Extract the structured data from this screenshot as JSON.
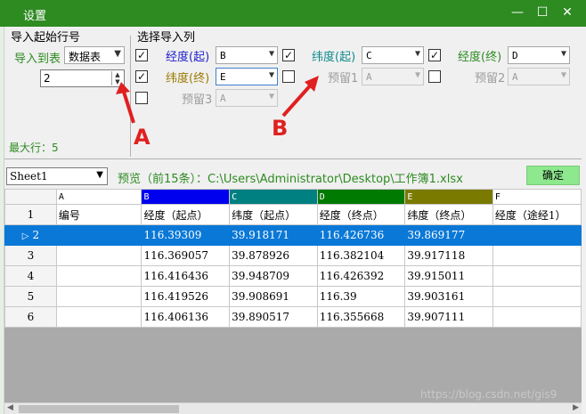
{
  "window": {
    "title": "设置"
  },
  "start_row_group": {
    "title": "导入起始行号",
    "import_to_label": "导入到表",
    "import_to_value": "数据表",
    "start_row_value": "2",
    "max_row_text": "最大行：5"
  },
  "columns_group": {
    "title": "选择导入列",
    "fields": [
      {
        "label": "经度(起)",
        "value": "B",
        "checked": "✓",
        "disabled": false
      },
      {
        "label": "纬度(起)",
        "value": "C",
        "checked": "✓",
        "disabled": false
      },
      {
        "label": "经度(终)",
        "value": "D",
        "checked": "✓",
        "disabled": false
      },
      {
        "label": "纬度(终)",
        "value": "E",
        "checked": "✓",
        "disabled": false
      },
      {
        "label": "预留1",
        "value": "A",
        "checked": "",
        "disabled": true
      },
      {
        "label": "预留2",
        "value": "A",
        "checked": "",
        "disabled": true
      },
      {
        "label": "预留3",
        "value": "A",
        "checked": "",
        "disabled": true
      }
    ],
    "row3_checkbox": ""
  },
  "annotations": {
    "a": "A",
    "b": "B"
  },
  "preview_bar": {
    "sheet": "Sheet1",
    "preview_text": "预览（前15条）：C:\\Users\\Administrator\\Desktop\\工作簿1.xlsx",
    "confirm_label": "确定"
  },
  "grid": {
    "column_letters": [
      "A",
      "B",
      "C",
      "D",
      "E",
      "F"
    ],
    "letter_colors": [
      "#ffffff",
      "#0000ee",
      "#008080",
      "#007a00",
      "#7a7a00",
      "#ffffff"
    ],
    "rows": [
      {
        "num": "1",
        "cells": [
          "编号",
          "经度（起点）",
          "纬度（起点）",
          "经度（终点）",
          "纬度（终点）",
          "经度（途经1）"
        ]
      },
      {
        "num": "2",
        "cells": [
          "",
          "116.39309",
          "39.918171",
          "116.426736",
          "39.869177",
          ""
        ]
      },
      {
        "num": "3",
        "cells": [
          "",
          "116.369057",
          "39.878926",
          "116.382104",
          "39.917118",
          ""
        ]
      },
      {
        "num": "4",
        "cells": [
          "",
          "116.416436",
          "39.948709",
          "116.426392",
          "39.915011",
          ""
        ]
      },
      {
        "num": "5",
        "cells": [
          "",
          "116.419526",
          "39.908691",
          "116.39",
          "39.903161",
          ""
        ]
      },
      {
        "num": "6",
        "cells": [
          "",
          "116.406136",
          "39.890517",
          "116.355668",
          "39.907111",
          ""
        ]
      }
    ],
    "selected_row": "2"
  },
  "watermark": "https://blog.csdn.net/gis9"
}
